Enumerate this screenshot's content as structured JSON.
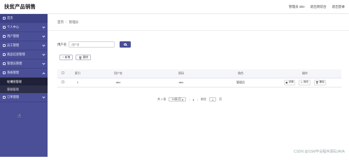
{
  "header": {
    "title": "扶贫产品销售",
    "links": [
      "管理员 abo",
      "退出到前台",
      "退出登录"
    ]
  },
  "sidebar": {
    "items": [
      {
        "label": "首页",
        "icon": "home-icon"
      },
      {
        "label": "个人中心",
        "icon": "user-icon"
      },
      {
        "label": "用户管理",
        "icon": "users-icon"
      },
      {
        "label": "员工管理",
        "icon": "staff-icon"
      },
      {
        "label": "商品信息管理",
        "icon": "goods-icon"
      },
      {
        "label": "管理员管理",
        "icon": "admin-icon"
      },
      {
        "label": "系统管理",
        "icon": "settings-icon"
      }
    ],
    "subitems": [
      "轮播图管理",
      "客服管理"
    ],
    "last_item": {
      "label": "订单管理",
      "icon": "order-icon"
    }
  },
  "breadcrumb": [
    "首页",
    "管理员"
  ],
  "search": {
    "label": "用户名",
    "placeholder": "用户名"
  },
  "toolbar": {
    "add": "新增",
    "delete": "删除"
  },
  "table": {
    "headers": [
      "索引",
      "用户名",
      "密码",
      "角色",
      "操作"
    ],
    "rows": [
      {
        "index": "1",
        "username": "abo",
        "password": "abo",
        "role": "管理员"
      }
    ],
    "actions": [
      "详情",
      "修改",
      "删除"
    ]
  },
  "pagination": {
    "total": "共 1 条",
    "page_size": "10条/页",
    "current": "1",
    "goto_label": "前往",
    "goto_value": "1",
    "page_unit": "页"
  },
  "watermark": "CSDN @SSM毕设程序源码JAVA",
  "colors": {
    "sidebar": "#4a4f97",
    "accent": "#4a4f97"
  }
}
